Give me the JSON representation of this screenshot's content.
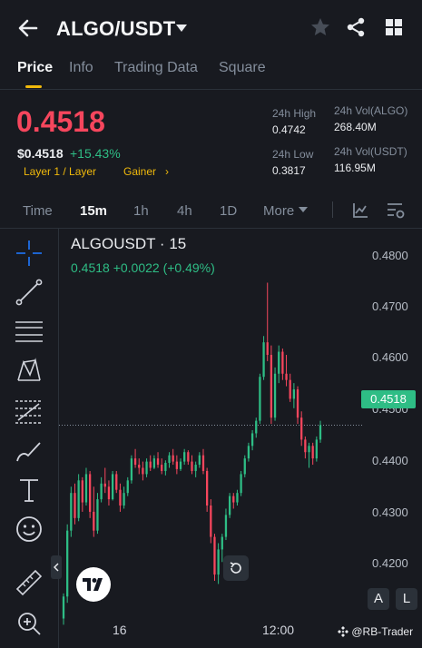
{
  "header": {
    "pair": "ALGO/USDT",
    "icons": [
      "back-arrow-icon",
      "caret-down-icon",
      "star-icon",
      "share-icon",
      "grid-icon"
    ]
  },
  "tabs": [
    {
      "label": "Price",
      "active": true
    },
    {
      "label": "Info",
      "active": false
    },
    {
      "label": "Trading Data",
      "active": false
    },
    {
      "label": "Square",
      "active": false
    }
  ],
  "price": {
    "last": "0.4518",
    "usd": "$0.4518",
    "change": "+15.43%",
    "tag1": "Layer 1 / Layer",
    "tag2": "Gainer",
    "tag2_arrow": "›"
  },
  "stats": {
    "high_label": "24h High",
    "high_value": "0.4742",
    "low_label": "24h Low",
    "low_value": "0.3817",
    "vol_base_label": "24h Vol(ALGO)",
    "vol_base_value": "268.40M",
    "vol_quote_label": "24h Vol(USDT)",
    "vol_quote_value": "116.95M"
  },
  "intervals": [
    {
      "label": "Time",
      "active": false
    },
    {
      "label": "15m",
      "active": true
    },
    {
      "label": "1h",
      "active": false
    },
    {
      "label": "4h",
      "active": false
    },
    {
      "label": "1D",
      "active": false
    },
    {
      "label": "More",
      "active": false
    }
  ],
  "chart": {
    "title": "ALGOUSDT · 15",
    "legend": "0.4518  +0.0022 (+0.49%)",
    "last_price_badge": "0.4518",
    "a_button": "A",
    "l_button": "L",
    "watermark": "@RB-Trader"
  },
  "colors": {
    "up": "#2ebd85",
    "down": "#f6465d",
    "accent": "#f0b90b",
    "background": "#181a20"
  },
  "chart_data": {
    "type": "candlestick",
    "y_ticks": [
      "0.4800",
      "0.4700",
      "0.4600",
      "0.4500",
      "0.4400",
      "0.4300",
      "0.4200"
    ],
    "ylim": [
      0.4163,
      0.4831
    ],
    "x_ticks": [
      "16",
      "12:00"
    ],
    "last_price": 0.4518,
    "candles": [
      [
        0.421,
        0.425,
        0.42,
        0.4245
      ],
      [
        0.4245,
        0.436,
        0.4235,
        0.435
      ],
      [
        0.435,
        0.442,
        0.434,
        0.441
      ],
      [
        0.441,
        0.4425,
        0.436,
        0.437
      ],
      [
        0.437,
        0.444,
        0.4365,
        0.443
      ],
      [
        0.443,
        0.4435,
        0.438,
        0.4395
      ],
      [
        0.4395,
        0.445,
        0.439,
        0.444
      ],
      [
        0.444,
        0.4445,
        0.437,
        0.438
      ],
      [
        0.438,
        0.442,
        0.434,
        0.435
      ],
      [
        0.435,
        0.441,
        0.4345,
        0.44
      ],
      [
        0.44,
        0.4435,
        0.4395,
        0.4425
      ],
      [
        0.4425,
        0.445,
        0.441,
        0.442
      ],
      [
        0.442,
        0.443,
        0.439,
        0.44
      ],
      [
        0.44,
        0.4445,
        0.4398,
        0.444
      ],
      [
        0.444,
        0.4445,
        0.441,
        0.4415
      ],
      [
        0.4415,
        0.4425,
        0.438,
        0.439
      ],
      [
        0.439,
        0.442,
        0.4385,
        0.441
      ],
      [
        0.441,
        0.4435,
        0.4405,
        0.443
      ],
      [
        0.443,
        0.447,
        0.4425,
        0.4465
      ],
      [
        0.4465,
        0.448,
        0.445,
        0.4455
      ],
      [
        0.4455,
        0.4465,
        0.444,
        0.445
      ],
      [
        0.445,
        0.446,
        0.443,
        0.444
      ],
      [
        0.444,
        0.4465,
        0.4435,
        0.446
      ],
      [
        0.446,
        0.447,
        0.4445,
        0.445
      ],
      [
        0.445,
        0.447,
        0.4448,
        0.4465
      ],
      [
        0.4465,
        0.4475,
        0.445,
        0.4455
      ],
      [
        0.4455,
        0.4465,
        0.444,
        0.4445
      ],
      [
        0.4445,
        0.4462,
        0.4438,
        0.4458
      ],
      [
        0.4458,
        0.4475,
        0.445,
        0.447
      ],
      [
        0.447,
        0.448,
        0.4455,
        0.446
      ],
      [
        0.446,
        0.447,
        0.444,
        0.4448
      ],
      [
        0.4448,
        0.4465,
        0.4445,
        0.446
      ],
      [
        0.446,
        0.448,
        0.4455,
        0.4475
      ],
      [
        0.4475,
        0.4478,
        0.4455,
        0.446
      ],
      [
        0.446,
        0.447,
        0.444,
        0.4445
      ],
      [
        0.4445,
        0.446,
        0.4435,
        0.4455
      ],
      [
        0.4455,
        0.4475,
        0.445,
        0.447
      ],
      [
        0.447,
        0.448,
        0.444,
        0.4445
      ],
      [
        0.4445,
        0.445,
        0.438,
        0.439
      ],
      [
        0.439,
        0.44,
        0.433,
        0.434
      ],
      [
        0.434,
        0.4345,
        0.427,
        0.428
      ],
      [
        0.428,
        0.433,
        0.4265,
        0.432
      ],
      [
        0.432,
        0.4345,
        0.43,
        0.434
      ],
      [
        0.434,
        0.4385,
        0.4335,
        0.4375
      ],
      [
        0.4375,
        0.441,
        0.437,
        0.4405
      ],
      [
        0.4405,
        0.441,
        0.4385,
        0.4395
      ],
      [
        0.4395,
        0.4415,
        0.439,
        0.441
      ],
      [
        0.441,
        0.4445,
        0.4405,
        0.444
      ],
      [
        0.444,
        0.447,
        0.4435,
        0.4465
      ],
      [
        0.4465,
        0.449,
        0.446,
        0.4485
      ],
      [
        0.4485,
        0.451,
        0.4478,
        0.4505
      ],
      [
        0.4505,
        0.453,
        0.4498,
        0.4525
      ],
      [
        0.4525,
        0.46,
        0.452,
        0.4595
      ],
      [
        0.4595,
        0.466,
        0.459,
        0.465
      ],
      [
        0.465,
        0.4745,
        0.462,
        0.463
      ],
      [
        0.463,
        0.4645,
        0.452,
        0.453
      ],
      [
        0.453,
        0.461,
        0.4525,
        0.46
      ],
      [
        0.46,
        0.4645,
        0.4585,
        0.4635
      ],
      [
        0.4635,
        0.464,
        0.459,
        0.46
      ],
      [
        0.46,
        0.463,
        0.458,
        0.459
      ],
      [
        0.459,
        0.46,
        0.4555,
        0.456
      ],
      [
        0.456,
        0.4585,
        0.4545,
        0.4575
      ],
      [
        0.4575,
        0.458,
        0.452,
        0.453
      ],
      [
        0.453,
        0.454,
        0.4485,
        0.4495
      ],
      [
        0.4495,
        0.45,
        0.4465,
        0.4475
      ],
      [
        0.4475,
        0.449,
        0.445,
        0.4485
      ],
      [
        0.4485,
        0.449,
        0.4455,
        0.4465
      ],
      [
        0.4465,
        0.45,
        0.446,
        0.4495
      ],
      [
        0.4495,
        0.4525,
        0.449,
        0.4518
      ]
    ]
  }
}
